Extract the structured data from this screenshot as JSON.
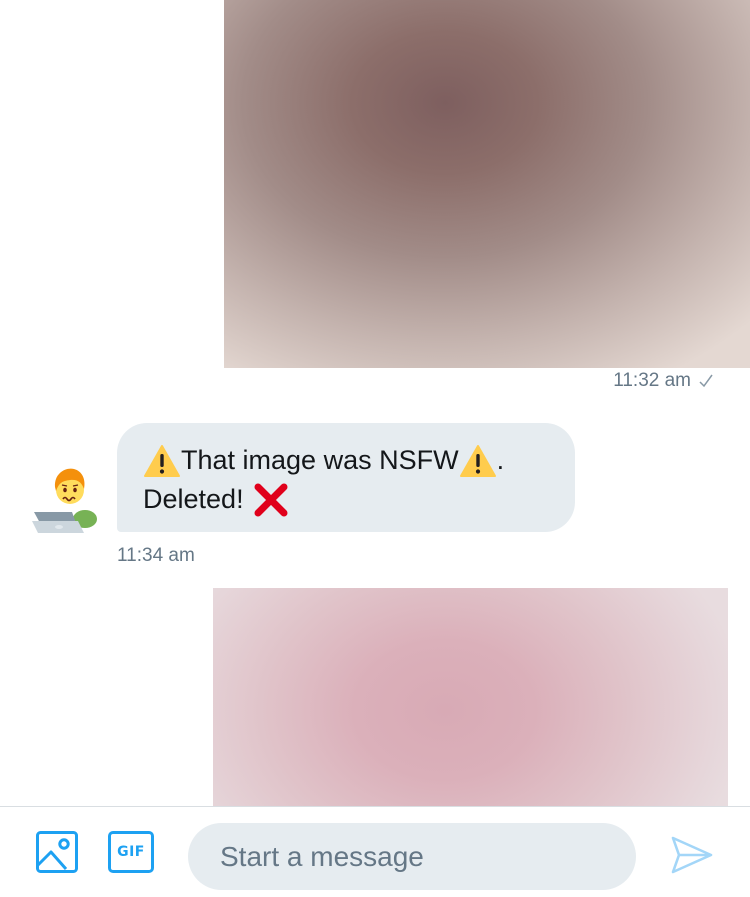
{
  "conversation": {
    "sent_image_1": {
      "timestamp": "11:32 am"
    },
    "received_message": {
      "line1_text": "That image was NSFW",
      "line1_suffix": ".",
      "line2_text": "Deleted!",
      "timestamp": "11:34 am"
    }
  },
  "composer": {
    "gif_label": "GIF",
    "placeholder": "Start a message"
  },
  "icons": {
    "sent_status": "check-icon",
    "warning": "warning-icon",
    "deleted": "cross-mark-icon",
    "media": "image-icon",
    "send": "send-icon"
  },
  "colors": {
    "accent": "#1da1f2",
    "bubble_background": "#e6ecf0",
    "muted_text": "#657786",
    "cross_mark": "#e0001b",
    "warning": "#ffcc4d"
  }
}
